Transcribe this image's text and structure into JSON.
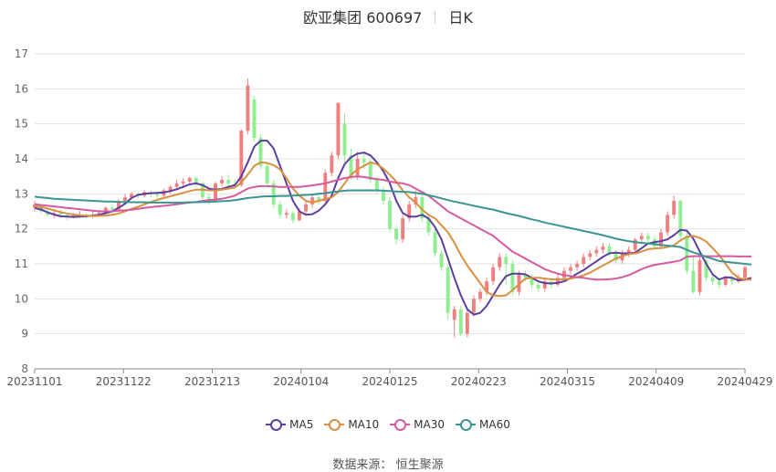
{
  "header": {
    "stock_title": "欧亚集团 600697",
    "period_label": "日K"
  },
  "legend": [
    {
      "name": "MA5",
      "color": "#5b3e9e"
    },
    {
      "name": "MA10",
      "color": "#d99040"
    },
    {
      "name": "MA30",
      "color": "#d45ba0"
    },
    {
      "name": "MA60",
      "color": "#3a9593"
    }
  ],
  "source": {
    "label": "数据来源：",
    "value": "恒生聚源"
  },
  "colors": {
    "up": "#f08080",
    "down": "#90ee90"
  },
  "chart_data": {
    "type": "line",
    "x_ticks": [
      "20231101",
      "20231122",
      "20231213",
      "20240104",
      "20240125",
      "20240223",
      "20240315",
      "20240409",
      "20240429"
    ],
    "y_ticks": [
      "8",
      "9",
      "10",
      "11",
      "12",
      "13",
      "14",
      "15",
      "16",
      "17"
    ],
    "ylim": [
      8,
      17
    ],
    "grid": true,
    "legend_position": "bottom",
    "candles": [
      [
        12.6,
        12.7,
        12.8,
        12.5
      ],
      [
        12.65,
        12.5,
        12.7,
        12.45
      ],
      [
        12.5,
        12.4,
        12.6,
        12.35
      ],
      [
        12.4,
        12.45,
        12.5,
        12.3
      ],
      [
        12.45,
        12.4,
        12.55,
        12.35
      ],
      [
        12.4,
        12.35,
        12.45,
        12.25
      ],
      [
        12.35,
        12.38,
        12.45,
        12.3
      ],
      [
        12.38,
        12.4,
        12.5,
        12.32
      ],
      [
        12.4,
        12.35,
        12.45,
        12.3
      ],
      [
        12.35,
        12.4,
        12.5,
        12.3
      ],
      [
        12.4,
        12.45,
        12.55,
        12.35
      ],
      [
        12.45,
        12.6,
        12.65,
        12.4
      ],
      [
        12.6,
        12.55,
        12.7,
        12.45
      ],
      [
        12.55,
        12.8,
        12.85,
        12.5
      ],
      [
        12.8,
        12.9,
        13.0,
        12.7
      ],
      [
        12.9,
        13.0,
        13.05,
        12.85
      ],
      [
        13.0,
        12.95,
        13.05,
        12.85
      ],
      [
        12.95,
        13.05,
        13.1,
        12.9
      ],
      [
        13.05,
        13.0,
        13.1,
        12.9
      ],
      [
        13.0,
        12.95,
        13.05,
        12.85
      ],
      [
        12.95,
        13.1,
        13.15,
        12.9
      ],
      [
        13.1,
        13.2,
        13.25,
        13.0
      ],
      [
        13.2,
        13.3,
        13.4,
        13.1
      ],
      [
        13.3,
        13.35,
        13.45,
        13.2
      ],
      [
        13.35,
        13.45,
        13.5,
        13.25
      ],
      [
        13.45,
        13.3,
        13.5,
        13.2
      ],
      [
        13.3,
        12.9,
        13.35,
        12.85
      ],
      [
        12.9,
        12.8,
        13.0,
        12.7
      ],
      [
        12.8,
        13.3,
        13.35,
        12.75
      ],
      [
        13.3,
        13.4,
        13.5,
        13.2
      ],
      [
        13.4,
        13.3,
        13.55,
        13.2
      ],
      [
        13.3,
        13.25,
        13.4,
        13.15
      ],
      [
        13.25,
        14.8,
        14.85,
        13.2
      ],
      [
        14.8,
        16.1,
        16.3,
        14.7
      ],
      [
        15.7,
        14.6,
        15.8,
        14.5
      ],
      [
        14.6,
        13.8,
        14.7,
        13.7
      ],
      [
        13.8,
        13.3,
        13.9,
        13.2
      ],
      [
        13.3,
        12.7,
        13.4,
        12.6
      ],
      [
        12.7,
        12.4,
        12.8,
        12.3
      ],
      [
        12.4,
        12.45,
        12.55,
        12.3
      ],
      [
        12.45,
        12.25,
        12.5,
        12.15
      ],
      [
        12.25,
        12.5,
        12.6,
        12.2
      ],
      [
        12.5,
        12.7,
        12.8,
        12.4
      ],
      [
        12.7,
        12.9,
        13.0,
        12.6
      ],
      [
        12.9,
        12.8,
        13.0,
        12.7
      ],
      [
        12.8,
        13.6,
        13.7,
        12.75
      ],
      [
        13.6,
        14.1,
        14.2,
        13.5
      ],
      [
        14.1,
        15.6,
        15.6,
        14.0
      ],
      [
        15.0,
        14.1,
        15.3,
        13.9
      ],
      [
        14.1,
        13.5,
        14.3,
        13.4
      ],
      [
        13.5,
        14.0,
        14.2,
        13.4
      ],
      [
        14.0,
        13.9,
        14.2,
        13.7
      ],
      [
        13.9,
        13.4,
        14.0,
        13.3
      ],
      [
        13.4,
        13.1,
        13.5,
        13.0
      ],
      [
        13.1,
        12.8,
        13.2,
        12.7
      ],
      [
        12.8,
        12.0,
        12.9,
        11.9
      ],
      [
        12.0,
        11.7,
        12.1,
        11.55
      ],
      [
        11.7,
        12.3,
        12.4,
        11.6
      ],
      [
        12.3,
        12.7,
        12.8,
        12.2
      ],
      [
        12.7,
        12.9,
        13.1,
        12.6
      ],
      [
        12.9,
        12.3,
        13.0,
        12.2
      ],
      [
        12.3,
        11.9,
        12.4,
        11.8
      ],
      [
        11.9,
        11.3,
        12.0,
        11.2
      ],
      [
        11.3,
        10.9,
        11.4,
        10.8
      ],
      [
        10.9,
        9.6,
        11.0,
        9.4
      ],
      [
        9.4,
        9.7,
        9.8,
        8.9
      ],
      [
        9.7,
        9.0,
        9.8,
        8.95
      ],
      [
        9.0,
        9.6,
        9.7,
        8.9
      ],
      [
        9.6,
        10.0,
        10.1,
        9.5
      ],
      [
        10.0,
        10.2,
        10.3,
        9.9
      ],
      [
        10.2,
        10.5,
        10.6,
        10.1
      ],
      [
        10.5,
        10.9,
        11.0,
        10.4
      ],
      [
        10.9,
        11.2,
        11.3,
        10.8
      ],
      [
        11.2,
        11.0,
        11.3,
        10.4
      ],
      [
        11.0,
        10.2,
        11.1,
        10.1
      ],
      [
        10.2,
        10.7,
        10.8,
        10.1
      ],
      [
        10.7,
        10.6,
        10.8,
        10.5
      ],
      [
        10.6,
        10.4,
        10.7,
        10.3
      ],
      [
        10.4,
        10.3,
        10.5,
        10.2
      ],
      [
        10.3,
        10.5,
        10.6,
        10.2
      ],
      [
        10.5,
        10.4,
        10.6,
        10.3
      ],
      [
        10.4,
        10.6,
        10.7,
        10.35
      ],
      [
        10.6,
        10.8,
        10.9,
        10.5
      ],
      [
        10.8,
        10.9,
        11.0,
        10.7
      ],
      [
        10.9,
        11.0,
        11.1,
        10.8
      ],
      [
        11.0,
        11.2,
        11.3,
        10.9
      ],
      [
        11.2,
        11.3,
        11.4,
        11.1
      ],
      [
        11.3,
        11.4,
        11.5,
        11.2
      ],
      [
        11.4,
        11.5,
        11.6,
        11.3
      ],
      [
        11.5,
        11.3,
        11.6,
        11.2
      ],
      [
        11.3,
        11.1,
        11.4,
        11.0
      ],
      [
        11.1,
        11.3,
        11.4,
        11.0
      ],
      [
        11.3,
        11.4,
        11.5,
        11.2
      ],
      [
        11.4,
        11.7,
        11.75,
        11.3
      ],
      [
        11.7,
        11.8,
        11.9,
        11.6
      ],
      [
        11.8,
        11.7,
        11.9,
        11.6
      ],
      [
        11.7,
        11.5,
        11.8,
        11.4
      ],
      [
        11.5,
        11.9,
        12.0,
        11.45
      ],
      [
        11.9,
        12.4,
        12.5,
        11.8
      ],
      [
        12.4,
        12.8,
        12.95,
        12.3
      ],
      [
        12.8,
        11.8,
        12.85,
        11.7
      ],
      [
        11.8,
        10.8,
        11.9,
        10.7
      ],
      [
        10.8,
        10.2,
        11.2,
        10.15
      ],
      [
        10.2,
        11.1,
        11.2,
        10.1
      ],
      [
        11.1,
        10.6,
        11.2,
        10.5
      ],
      [
        10.6,
        10.5,
        10.7,
        10.4
      ],
      [
        10.5,
        10.4,
        10.6,
        10.3
      ],
      [
        10.4,
        10.6,
        10.65,
        10.35
      ],
      [
        10.6,
        10.5,
        10.65,
        10.4
      ],
      [
        10.5,
        10.6,
        10.7,
        10.45
      ],
      [
        10.6,
        10.9,
        10.95,
        10.5
      ]
    ],
    "series": [
      {
        "name": "MA5",
        "values": [
          12.6,
          12.55,
          12.47,
          12.41,
          12.36,
          12.35,
          12.34,
          12.35,
          12.36,
          12.38,
          12.4,
          12.45,
          12.5,
          12.6,
          12.72,
          12.88,
          12.97,
          13.0,
          13.02,
          13.03,
          13.04,
          13.08,
          13.13,
          13.2,
          13.27,
          13.3,
          13.25,
          13.15,
          13.12,
          13.14,
          13.2,
          13.25,
          13.5,
          13.9,
          14.35,
          14.52,
          14.52,
          14.3,
          13.8,
          13.3,
          12.8,
          12.5,
          12.4,
          12.42,
          12.52,
          12.7,
          12.95,
          13.45,
          13.85,
          14.05,
          14.15,
          14.18,
          14.1,
          13.9,
          13.65,
          13.3,
          12.8,
          12.45,
          12.35,
          12.35,
          12.4,
          12.3,
          12.05,
          11.7,
          11.15,
          10.6,
          10.1,
          9.7,
          9.55,
          9.6,
          9.8,
          10.1,
          10.4,
          10.65,
          10.72,
          10.72,
          10.7,
          10.6,
          10.5,
          10.45,
          10.44,
          10.46,
          10.5,
          10.6,
          10.72,
          10.82,
          10.95,
          11.07,
          11.2,
          11.3,
          11.32,
          11.3,
          11.3,
          11.32,
          11.45,
          11.58,
          11.62,
          11.65,
          11.7,
          11.82,
          11.97,
          11.95,
          11.72,
          11.35,
          11.0,
          10.7,
          10.55,
          10.62,
          10.6,
          10.53,
          10.55,
          10.6
        ]
      },
      {
        "name": "MA10",
        "values": [
          12.65,
          12.62,
          12.58,
          12.53,
          12.48,
          12.44,
          12.41,
          12.39,
          12.38,
          12.37,
          12.37,
          12.38,
          12.4,
          12.44,
          12.5,
          12.57,
          12.63,
          12.7,
          12.77,
          12.83,
          12.88,
          12.93,
          12.98,
          13.03,
          13.08,
          13.12,
          13.12,
          13.1,
          13.1,
          13.12,
          13.15,
          13.18,
          13.32,
          13.55,
          13.8,
          13.9,
          13.88,
          13.82,
          13.7,
          13.45,
          13.15,
          12.95,
          12.8,
          12.75,
          12.8,
          12.85,
          12.9,
          13.05,
          13.3,
          13.55,
          13.7,
          13.8,
          13.9,
          13.85,
          13.72,
          13.55,
          13.35,
          13.1,
          12.9,
          12.75,
          12.55,
          12.4,
          12.3,
          12.1,
          11.9,
          11.6,
          11.25,
          10.95,
          10.7,
          10.45,
          10.2,
          10.1,
          10.08,
          10.1,
          10.25,
          10.42,
          10.58,
          10.6,
          10.6,
          10.58,
          10.56,
          10.55,
          10.56,
          10.58,
          10.62,
          10.67,
          10.75,
          10.85,
          10.95,
          11.05,
          11.15,
          11.22,
          11.28,
          11.3,
          11.35,
          11.42,
          11.44,
          11.45,
          11.48,
          11.53,
          11.67,
          11.77,
          11.8,
          11.74,
          11.64,
          11.45,
          11.25,
          11.0,
          10.75,
          10.6,
          10.55,
          10.55
        ]
      },
      {
        "name": "MA30",
        "values": [
          12.7,
          12.68,
          12.66,
          12.64,
          12.62,
          12.6,
          12.58,
          12.56,
          12.54,
          12.52,
          12.5,
          12.5,
          12.5,
          12.52,
          12.53,
          12.55,
          12.57,
          12.6,
          12.62,
          12.64,
          12.66,
          12.68,
          12.7,
          12.73,
          12.75,
          12.77,
          12.8,
          12.82,
          12.84,
          12.86,
          12.9,
          12.95,
          13.05,
          13.15,
          13.2,
          13.22,
          13.22,
          13.21,
          13.2,
          13.2,
          13.2,
          13.2,
          13.22,
          13.24,
          13.27,
          13.3,
          13.35,
          13.4,
          13.45,
          13.48,
          13.5,
          13.48,
          13.45,
          13.42,
          13.4,
          13.35,
          13.32,
          13.3,
          13.25,
          13.15,
          13.05,
          12.95,
          12.8,
          12.65,
          12.5,
          12.4,
          12.3,
          12.2,
          12.1,
          12.0,
          11.9,
          11.8,
          11.65,
          11.5,
          11.35,
          11.25,
          11.15,
          11.05,
          10.95,
          10.85,
          10.78,
          10.72,
          10.68,
          10.65,
          10.62,
          10.6,
          10.57,
          10.55,
          10.55,
          10.56,
          10.58,
          10.62,
          10.68,
          10.76,
          10.85,
          10.92,
          10.97,
          11.0,
          11.03,
          11.06,
          11.1,
          11.2,
          11.22,
          11.22,
          11.22,
          11.22,
          11.22,
          11.22,
          11.22,
          11.21,
          11.21,
          11.21
        ]
      },
      {
        "name": "MA60",
        "values": [
          12.92,
          12.9,
          12.88,
          12.86,
          12.85,
          12.84,
          12.83,
          12.82,
          12.81,
          12.8,
          12.79,
          12.78,
          12.78,
          12.77,
          12.77,
          12.76,
          12.76,
          12.76,
          12.75,
          12.75,
          12.75,
          12.75,
          12.75,
          12.75,
          12.76,
          12.76,
          12.77,
          12.77,
          12.78,
          12.79,
          12.8,
          12.82,
          12.85,
          12.88,
          12.9,
          12.92,
          12.93,
          12.93,
          12.94,
          12.94,
          12.95,
          12.96,
          12.97,
          12.98,
          13.0,
          13.02,
          13.05,
          13.07,
          13.09,
          13.1,
          13.1,
          13.1,
          13.1,
          13.1,
          13.09,
          13.08,
          13.07,
          13.06,
          13.05,
          13.03,
          13.0,
          12.96,
          12.92,
          12.87,
          12.82,
          12.78,
          12.74,
          12.7,
          12.66,
          12.62,
          12.58,
          12.55,
          12.5,
          12.45,
          12.41,
          12.37,
          12.32,
          12.27,
          12.23,
          12.18,
          12.14,
          12.1,
          12.06,
          12.02,
          11.98,
          11.94,
          11.9,
          11.86,
          11.82,
          11.77,
          11.72,
          11.68,
          11.65,
          11.62,
          11.6,
          11.58,
          11.56,
          11.54,
          11.52,
          11.5,
          11.48,
          11.4,
          11.33,
          11.27,
          11.2,
          11.14,
          11.08,
          11.06,
          11.04,
          11.02,
          11.0,
          10.98
        ]
      }
    ]
  }
}
